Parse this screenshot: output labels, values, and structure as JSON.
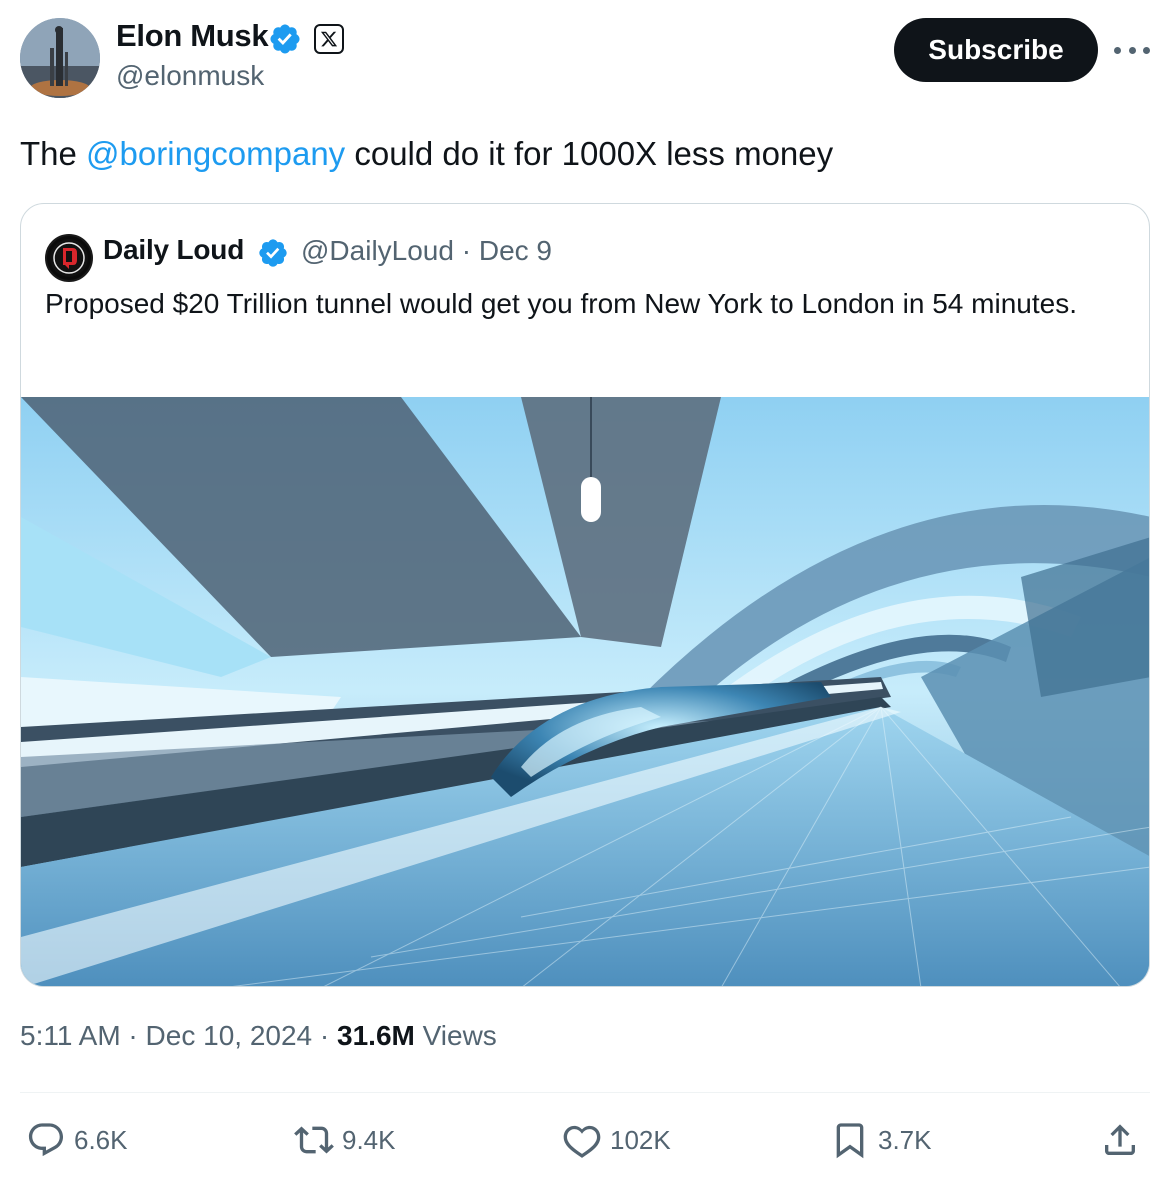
{
  "author": {
    "display_name": "Elon Musk",
    "handle": "@elonmusk",
    "avatar_icon": "rocket-launch-avatar",
    "verified_icon": "verified-badge-icon",
    "affiliate_icon": "x-logo-icon"
  },
  "header": {
    "subscribe_label": "Subscribe",
    "more_icon": "more-icon"
  },
  "tweet": {
    "text_prefix": "The ",
    "mention": "@boringcompany",
    "text_suffix": " could do it for 1000X less money"
  },
  "quote": {
    "display_name": "Daily Loud",
    "handle": "@DailyLoud",
    "separator": " · ",
    "date": "Dec 9",
    "text": "Proposed $20 Trillion tunnel would get you from New York to London in 54 minutes.",
    "avatar_icon": "daily-loud-logo",
    "media_description_icon": "hyperloop-tunnel-image"
  },
  "meta": {
    "time": "5:11 AM",
    "sep1": " · ",
    "date": "Dec 10, 2024",
    "sep2": " · ",
    "views_count": "31.6M",
    "views_label": " Views"
  },
  "actions": {
    "replies": "6.6K",
    "reposts": "9.4K",
    "likes": "102K",
    "bookmarks": "3.7K"
  },
  "colors": {
    "accent": "#1d9bf0",
    "text": "#0f1419",
    "secondary": "#536471",
    "border": "#cfd9de"
  }
}
